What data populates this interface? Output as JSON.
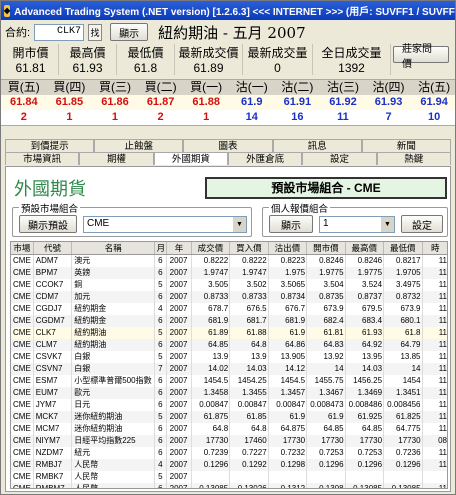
{
  "window": {
    "title": "Advanced Trading System (.NET version) [1.2.6.3] <<< INTERNET >>> (用戶: SUVFF1 / SUVFF1) ***"
  },
  "contract": {
    "label": "合約:",
    "code": "CLK7",
    "search_btn": "找",
    "show_btn": "顯示",
    "product_name": "紐約期油 - 五月 2007"
  },
  "quote": {
    "headers": [
      "開市價",
      "最高價",
      "最低價",
      "最新成交價",
      "最新成交量",
      "全日成交量"
    ],
    "values": [
      "61.81",
      "61.93",
      "61.8",
      "61.89",
      "0",
      "1392"
    ],
    "broker_btn": "莊家問價"
  },
  "depth": {
    "headers": [
      "買(五)",
      "買(四)",
      "買(三)",
      "買(二)",
      "買(一)",
      "沽(一)",
      "沽(二)",
      "沽(三)",
      "沽(四)",
      "沽(五)"
    ],
    "prices": [
      "61.84",
      "61.85",
      "61.86",
      "61.87",
      "61.88",
      "61.9",
      "61.91",
      "61.92",
      "61.93",
      "61.94"
    ],
    "volumes": [
      "2",
      "1",
      "1",
      "2",
      "1",
      "14",
      "16",
      "11",
      "7",
      "10"
    ]
  },
  "tabs": {
    "row1": [
      "到價提示",
      "止蝕盤",
      "圖表",
      "訊息",
      "新聞"
    ],
    "row2": [
      "市場資訊",
      "期權",
      "外國期貨",
      "外匯倉底",
      "設定",
      "熱鍵"
    ],
    "active": "外國期貨"
  },
  "panel": {
    "title": "外國期貨",
    "default_market": "預設市場組合 - CME",
    "market_group_title": "預設市場組合",
    "show_default_btn": "顯示預設",
    "market_value": "CME",
    "personal_group_title": "個人報價組合",
    "show_btn": "顯示",
    "personal_value": "1",
    "settings_btn": "設定"
  },
  "table": {
    "headers": [
      "市場",
      "代號",
      "名稱",
      "月",
      "年",
      "成交價",
      "買入價",
      "沽出價",
      "開市價",
      "最高價",
      "最低價",
      "時"
    ],
    "rows": [
      [
        "CME",
        "ADM7",
        "澳元",
        "6",
        "2007",
        "0.8222",
        "0.8222",
        "0.8223",
        "0.8246",
        "0.8246",
        "0.8217",
        "11"
      ],
      [
        "CME",
        "BPM7",
        "英鎊",
        "6",
        "2007",
        "1.9747",
        "1.9747",
        "1.975",
        "1.9775",
        "1.9775",
        "1.9705",
        "11"
      ],
      [
        "CME",
        "CCOK7",
        "銅",
        "5",
        "2007",
        "3.505",
        "3.502",
        "3.5065",
        "3.504",
        "3.524",
        "3.4975",
        "11"
      ],
      [
        "CME",
        "CDM7",
        "加元",
        "6",
        "2007",
        "0.8733",
        "0.8733",
        "0.8734",
        "0.8735",
        "0.8737",
        "0.8732",
        "11"
      ],
      [
        "CME",
        "CGDJ7",
        "紐約期金",
        "4",
        "2007",
        "678.7",
        "676.5",
        "676.7",
        "673.9",
        "679.5",
        "673.9",
        "11"
      ],
      [
        "CME",
        "CGDM7",
        "紐約期金",
        "6",
        "2007",
        "681.9",
        "681.7",
        "681.9",
        "682.4",
        "683.4",
        "680.1",
        "11"
      ],
      [
        "CME",
        "CLK7",
        "紐約期油",
        "5",
        "2007",
        "61.89",
        "61.88",
        "61.9",
        "61.81",
        "61.93",
        "61.8",
        "11"
      ],
      [
        "CME",
        "CLM7",
        "紐約期油",
        "6",
        "2007",
        "64.85",
        "64.8",
        "64.86",
        "64.83",
        "64.92",
        "64.79",
        "11"
      ],
      [
        "CME",
        "CSVK7",
        "白銀",
        "5",
        "2007",
        "13.9",
        "13.9",
        "13.905",
        "13.92",
        "13.95",
        "13.85",
        "11"
      ],
      [
        "CME",
        "CSVN7",
        "白銀",
        "7",
        "2007",
        "14.02",
        "14.03",
        "14.12",
        "14",
        "14.03",
        "14",
        "11"
      ],
      [
        "CME",
        "ESM7",
        "小型標準普爾500指數",
        "6",
        "2007",
        "1454.5",
        "1454.25",
        "1454.5",
        "1455.75",
        "1456.25",
        "1454",
        "11"
      ],
      [
        "CME",
        "EUM7",
        "歐元",
        "6",
        "2007",
        "1.3458",
        "1.3455",
        "1.3457",
        "1.3467",
        "1.3469",
        "1.3451",
        "11"
      ],
      [
        "CME",
        "JYM7",
        "日元",
        "6",
        "2007",
        "0.00847",
        "0.00847",
        "0.00847",
        "0.008473",
        "0.008486",
        "0.008456",
        "11"
      ],
      [
        "CME",
        "MCK7",
        "迷你紐約期油",
        "5",
        "2007",
        "61.875",
        "61.85",
        "61.9",
        "61.9",
        "61.925",
        "61.825",
        "11"
      ],
      [
        "CME",
        "MCM7",
        "迷你紐約期油",
        "6",
        "2007",
        "64.8",
        "64.8",
        "64.875",
        "64.85",
        "64.85",
        "64.775",
        "11"
      ],
      [
        "CME",
        "NIYM7",
        "日經平均指數225",
        "6",
        "2007",
        "17730",
        "17460",
        "17730",
        "17730",
        "17730",
        "17730",
        "08"
      ],
      [
        "CME",
        "NZDM7",
        "紐元",
        "6",
        "2007",
        "0.7239",
        "0.7227",
        "0.7232",
        "0.7253",
        "0.7253",
        "0.7236",
        "11"
      ],
      [
        "CME",
        "RMBJ7",
        "人民幣",
        "4",
        "2007",
        "0.1296",
        "0.1292",
        "0.1298",
        "0.1296",
        "0.1296",
        "0.1296",
        "11"
      ],
      [
        "CME",
        "RMBK7",
        "人民幣",
        "5",
        "2007",
        "",
        "",
        "",
        "",
        "",
        "",
        ""
      ],
      [
        "CME",
        "RMBM7",
        "人民幣",
        "6",
        "2007",
        "0.13085",
        "0.13026",
        "0.1312",
        "0.1308",
        "0.13085",
        "0.13085",
        "11"
      ]
    ]
  }
}
